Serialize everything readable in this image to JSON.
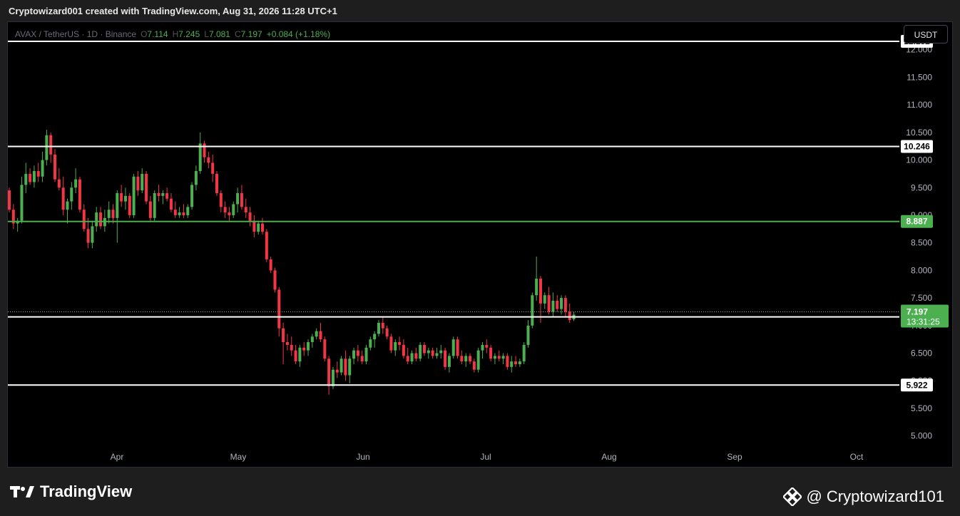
{
  "header": {
    "attribution": "Cryptowizard001 created with TradingView.com, Aug 31, 2026 11:28 UTC+1"
  },
  "legend": {
    "symbol": "AVAX / TetherUS · 1D · Binance",
    "open_key": "O",
    "open": "7.114",
    "high_key": "H",
    "high": "7.245",
    "low_key": "L",
    "low": "7.081",
    "close_key": "C",
    "close": "7.197",
    "change": "+0.084 (+1.18%)"
  },
  "currency_button": "USDT",
  "footer": {
    "brand": "TradingView",
    "handle": "@ Cryptowizard101"
  },
  "colors": {
    "up": "#4caf50",
    "down": "#f23645",
    "level_line": "#ffffff",
    "current_level_line": "#4caf50",
    "background": "#000000"
  },
  "chart_data": {
    "type": "candlestick",
    "ylim": [
      4.75,
      12.5
    ],
    "y_ticks": [
      "12.000",
      "11.500",
      "11.000",
      "10.500",
      "10.000",
      "9.500",
      "9.000",
      "8.500",
      "8.000",
      "7.500",
      "7.000",
      "6.500",
      "6.000",
      "5.500",
      "5.000"
    ],
    "x_labels": [
      "Apr",
      "May",
      "Jun",
      "Jul",
      "Aug",
      "Sep",
      "Oct"
    ],
    "horizontal_levels": [
      {
        "price": 12.152,
        "label": "12.152",
        "style": "white"
      },
      {
        "price": 10.246,
        "label": "10.246",
        "style": "white"
      },
      {
        "price": 8.887,
        "label": "8.887",
        "style": "green"
      },
      {
        "price": 7.158,
        "label": "7.158",
        "style": "white"
      },
      {
        "price": 5.922,
        "label": "5.922",
        "style": "white"
      }
    ],
    "current_price": {
      "price": 7.197,
      "label": "7.197",
      "countdown": "13:31:25"
    },
    "candles": [
      [
        9.45,
        9.5,
        9.05,
        9.1
      ],
      [
        9.1,
        9.2,
        8.75,
        8.85
      ],
      [
        8.85,
        8.95,
        8.7,
        8.9
      ],
      [
        8.9,
        9.7,
        8.85,
        9.55
      ],
      [
        9.55,
        9.95,
        9.4,
        9.75
      ],
      [
        9.75,
        9.85,
        9.55,
        9.6
      ],
      [
        9.6,
        9.9,
        9.5,
        9.8
      ],
      [
        9.8,
        9.95,
        9.6,
        9.7
      ],
      [
        9.7,
        10.15,
        9.6,
        10.0
      ],
      [
        10.0,
        10.55,
        9.9,
        10.45
      ],
      [
        10.45,
        10.5,
        9.95,
        10.1
      ],
      [
        10.1,
        10.2,
        9.6,
        9.65
      ],
      [
        9.65,
        9.85,
        9.45,
        9.5
      ],
      [
        9.5,
        9.7,
        9.0,
        9.1
      ],
      [
        9.1,
        9.3,
        8.85,
        9.25
      ],
      [
        9.25,
        9.6,
        9.1,
        9.5
      ],
      [
        9.5,
        9.85,
        9.4,
        9.65
      ],
      [
        9.65,
        9.7,
        9.05,
        9.1
      ],
      [
        9.1,
        9.2,
        8.7,
        8.75
      ],
      [
        8.75,
        8.95,
        8.4,
        8.5
      ],
      [
        8.5,
        8.9,
        8.4,
        8.8
      ],
      [
        8.8,
        9.15,
        8.7,
        9.05
      ],
      [
        9.05,
        9.15,
        8.75,
        8.8
      ],
      [
        8.8,
        9.1,
        8.7,
        8.95
      ],
      [
        8.95,
        9.25,
        8.85,
        9.1
      ],
      [
        9.1,
        9.2,
        8.85,
        8.95
      ],
      [
        8.95,
        9.45,
        8.5,
        9.4
      ],
      [
        9.4,
        9.55,
        9.15,
        9.25
      ],
      [
        9.25,
        9.5,
        9.1,
        9.35
      ],
      [
        9.35,
        9.4,
        8.95,
        9.0
      ],
      [
        9.0,
        9.75,
        8.95,
        9.7
      ],
      [
        9.7,
        9.8,
        9.35,
        9.45
      ],
      [
        9.45,
        9.85,
        9.4,
        9.75
      ],
      [
        9.75,
        9.8,
        9.2,
        9.25
      ],
      [
        9.25,
        9.35,
        8.9,
        8.95
      ],
      [
        8.95,
        9.45,
        8.9,
        9.4
      ],
      [
        9.4,
        9.55,
        9.25,
        9.35
      ],
      [
        9.35,
        9.45,
        9.2,
        9.4
      ],
      [
        9.4,
        9.5,
        9.25,
        9.3
      ],
      [
        9.3,
        9.4,
        9.05,
        9.1
      ],
      [
        9.1,
        9.25,
        8.95,
        9.0
      ],
      [
        9.0,
        9.15,
        8.95,
        9.05
      ],
      [
        9.05,
        9.2,
        8.95,
        9.0
      ],
      [
        9.0,
        9.2,
        8.95,
        9.15
      ],
      [
        9.15,
        9.6,
        9.1,
        9.55
      ],
      [
        9.55,
        9.9,
        9.45,
        9.8
      ],
      [
        9.8,
        10.5,
        9.75,
        10.3
      ],
      [
        10.3,
        10.35,
        9.95,
        10.05
      ],
      [
        10.05,
        10.15,
        9.85,
        9.95
      ],
      [
        9.95,
        10.1,
        9.6,
        9.75
      ],
      [
        9.75,
        9.8,
        9.35,
        9.4
      ],
      [
        9.4,
        9.45,
        9.05,
        9.15
      ],
      [
        9.15,
        9.25,
        8.95,
        9.05
      ],
      [
        9.05,
        9.15,
        8.9,
        9.0
      ],
      [
        9.0,
        9.25,
        8.95,
        9.2
      ],
      [
        9.2,
        9.5,
        9.05,
        9.4
      ],
      [
        9.4,
        9.55,
        9.1,
        9.15
      ],
      [
        9.15,
        9.3,
        8.95,
        9.05
      ],
      [
        9.05,
        9.15,
        8.8,
        8.9
      ],
      [
        8.9,
        9.0,
        8.6,
        8.7
      ],
      [
        8.7,
        8.9,
        8.65,
        8.85
      ],
      [
        8.85,
        8.95,
        8.65,
        8.7
      ],
      [
        8.7,
        8.75,
        8.15,
        8.2
      ],
      [
        8.2,
        8.25,
        7.95,
        8.0
      ],
      [
        8.0,
        8.05,
        7.6,
        7.65
      ],
      [
        7.65,
        7.7,
        6.8,
        6.95
      ],
      [
        6.95,
        7.05,
        6.3,
        6.7
      ],
      [
        6.7,
        6.85,
        6.55,
        6.65
      ],
      [
        6.65,
        6.8,
        6.45,
        6.55
      ],
      [
        6.55,
        6.65,
        6.3,
        6.35
      ],
      [
        6.35,
        6.65,
        6.25,
        6.6
      ],
      [
        6.6,
        6.7,
        6.45,
        6.55
      ],
      [
        6.55,
        6.75,
        6.45,
        6.7
      ],
      [
        6.7,
        6.85,
        6.6,
        6.8
      ],
      [
        6.8,
        6.95,
        6.75,
        6.9
      ],
      [
        6.9,
        7.05,
        6.7,
        6.75
      ],
      [
        6.75,
        6.8,
        6.35,
        6.4
      ],
      [
        6.4,
        6.45,
        5.75,
        5.9
      ],
      [
        5.9,
        6.25,
        5.85,
        6.2
      ],
      [
        6.2,
        6.35,
        6.05,
        6.15
      ],
      [
        6.15,
        6.45,
        6.1,
        6.4
      ],
      [
        6.4,
        6.55,
        6.0,
        6.1
      ],
      [
        6.1,
        6.45,
        5.95,
        6.4
      ],
      [
        6.4,
        6.6,
        6.3,
        6.55
      ],
      [
        6.55,
        6.65,
        6.35,
        6.45
      ],
      [
        6.45,
        6.55,
        6.3,
        6.35
      ],
      [
        6.35,
        6.65,
        6.3,
        6.6
      ],
      [
        6.6,
        6.8,
        6.55,
        6.75
      ],
      [
        6.75,
        6.9,
        6.6,
        6.85
      ],
      [
        6.85,
        7.1,
        6.8,
        7.05
      ],
      [
        7.05,
        7.15,
        6.85,
        6.95
      ],
      [
        6.95,
        7.0,
        6.75,
        6.8
      ],
      [
        6.8,
        6.85,
        6.5,
        6.55
      ],
      [
        6.55,
        6.75,
        6.45,
        6.7
      ],
      [
        6.7,
        6.8,
        6.55,
        6.65
      ],
      [
        6.65,
        6.75,
        6.4,
        6.45
      ],
      [
        6.45,
        6.6,
        6.3,
        6.35
      ],
      [
        6.35,
        6.55,
        6.3,
        6.5
      ],
      [
        6.5,
        6.6,
        6.35,
        6.4
      ],
      [
        6.4,
        6.7,
        6.35,
        6.65
      ],
      [
        6.65,
        6.7,
        6.45,
        6.5
      ],
      [
        6.5,
        6.6,
        6.4,
        6.55
      ],
      [
        6.55,
        6.6,
        6.4,
        6.45
      ],
      [
        6.45,
        6.6,
        6.4,
        6.5
      ],
      [
        6.5,
        6.65,
        6.4,
        6.55
      ],
      [
        6.55,
        6.6,
        6.2,
        6.25
      ],
      [
        6.25,
        6.5,
        6.15,
        6.45
      ],
      [
        6.45,
        6.8,
        6.4,
        6.75
      ],
      [
        6.75,
        6.8,
        6.4,
        6.45
      ],
      [
        6.45,
        6.55,
        6.3,
        6.35
      ],
      [
        6.35,
        6.5,
        6.25,
        6.45
      ],
      [
        6.45,
        6.5,
        6.3,
        6.35
      ],
      [
        6.35,
        6.4,
        6.15,
        6.2
      ],
      [
        6.2,
        6.6,
        6.15,
        6.55
      ],
      [
        6.55,
        6.7,
        6.4,
        6.65
      ],
      [
        6.65,
        6.75,
        6.5,
        6.6
      ],
      [
        6.6,
        6.65,
        6.35,
        6.4
      ],
      [
        6.4,
        6.5,
        6.3,
        6.45
      ],
      [
        6.45,
        6.55,
        6.35,
        6.4
      ],
      [
        6.4,
        6.5,
        6.3,
        6.45
      ],
      [
        6.45,
        6.5,
        6.2,
        6.25
      ],
      [
        6.25,
        6.45,
        6.15,
        6.35
      ],
      [
        6.35,
        6.45,
        6.25,
        6.3
      ],
      [
        6.3,
        6.4,
        6.25,
        6.35
      ],
      [
        6.35,
        6.7,
        6.3,
        6.65
      ],
      [
        6.65,
        7.1,
        6.6,
        7.0
      ],
      [
        7.0,
        7.6,
        6.95,
        7.55
      ],
      [
        7.55,
        8.25,
        7.45,
        7.85
      ],
      [
        7.85,
        7.9,
        7.05,
        7.4
      ],
      [
        7.4,
        7.6,
        7.3,
        7.55
      ],
      [
        7.55,
        7.7,
        7.2,
        7.25
      ],
      [
        7.25,
        7.6,
        7.15,
        7.45
      ],
      [
        7.45,
        7.55,
        7.25,
        7.3
      ],
      [
        7.3,
        7.55,
        7.2,
        7.5
      ],
      [
        7.5,
        7.55,
        7.15,
        7.25
      ],
      [
        7.25,
        7.4,
        7.05,
        7.1
      ],
      [
        7.114,
        7.245,
        7.081,
        7.197
      ]
    ]
  }
}
